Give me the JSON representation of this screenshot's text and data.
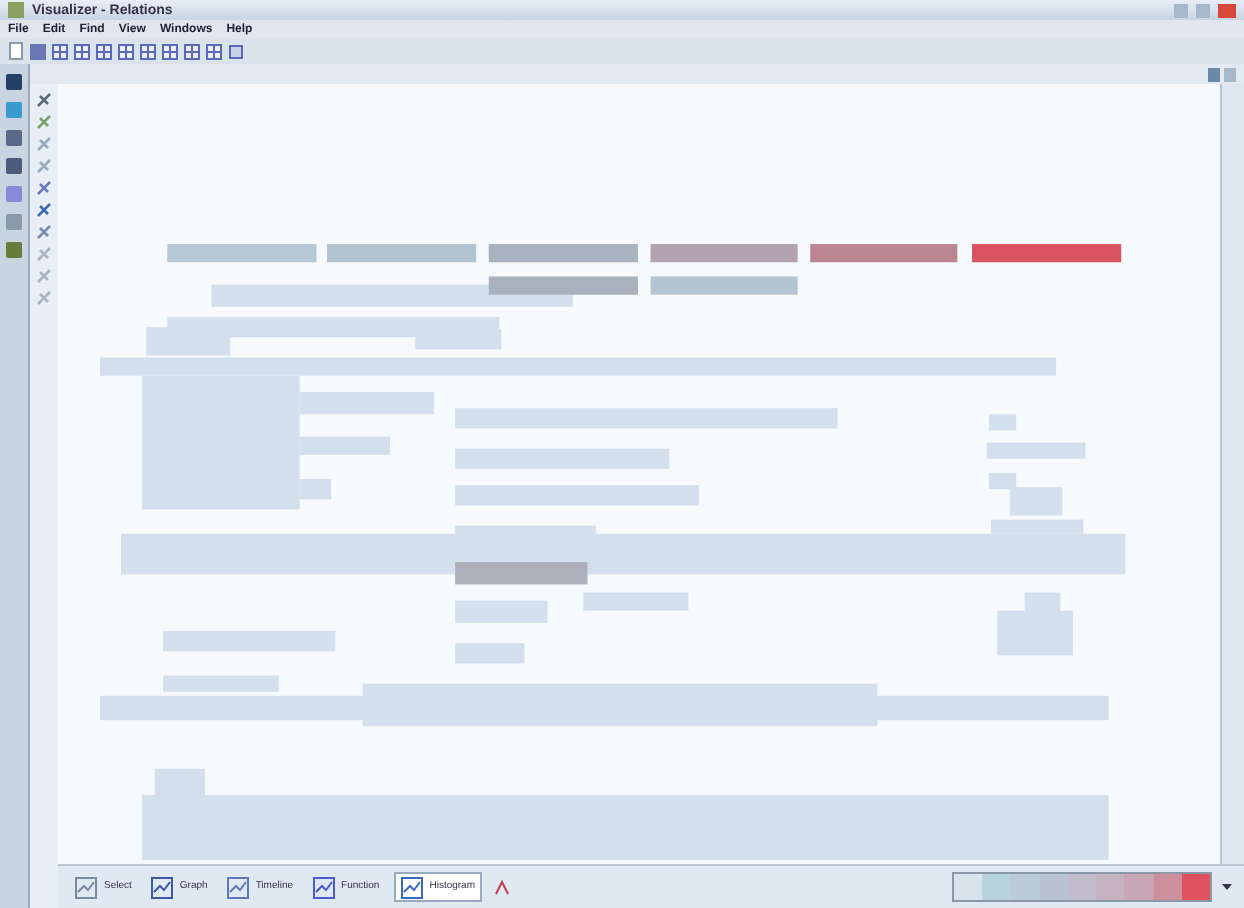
{
  "window": {
    "title": "Visualizer - Relations"
  },
  "menu": [
    "File",
    "Edit",
    "Find",
    "View",
    "Windows",
    "Help"
  ],
  "bottom_tabs": [
    {
      "label": "Select",
      "selected": false
    },
    {
      "label": "Graph",
      "selected": false
    },
    {
      "label": "Timeline",
      "selected": false
    },
    {
      "label": "Function",
      "selected": false
    },
    {
      "label": "Histogram",
      "selected": true
    }
  ]
}
